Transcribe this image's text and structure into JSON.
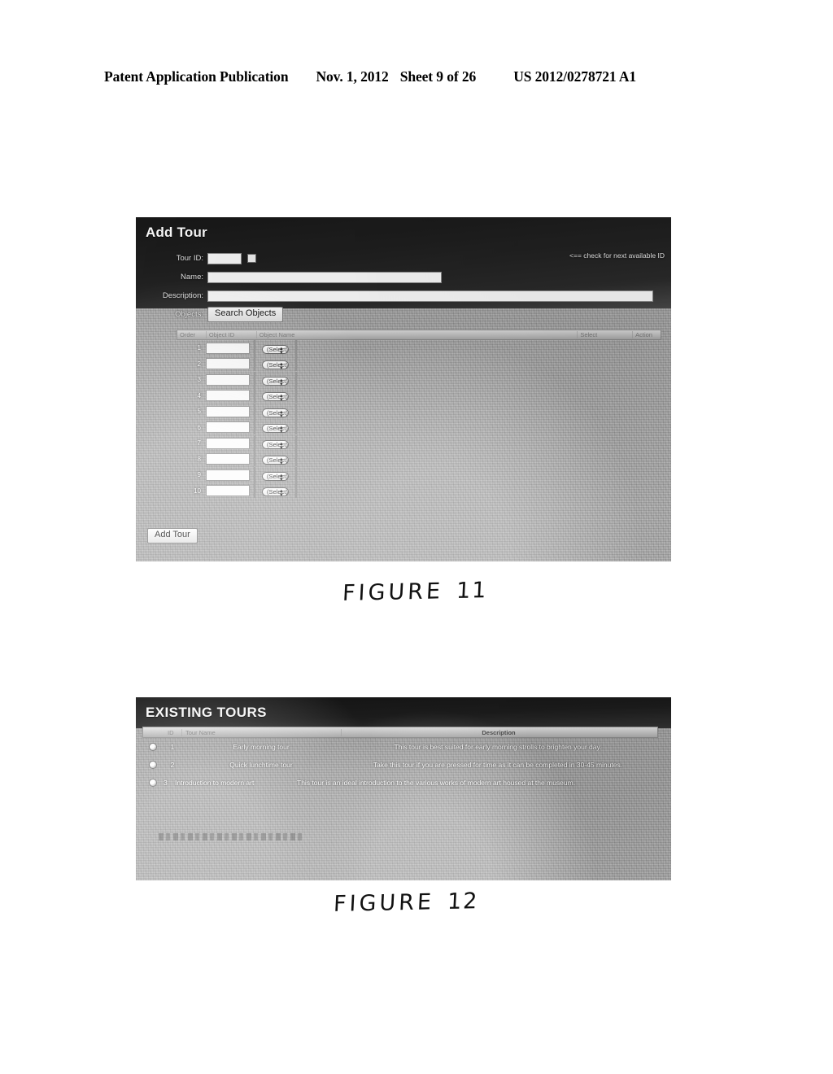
{
  "header": {
    "publication": "Patent Application Publication",
    "date": "Nov. 1, 2012",
    "sheet": "Sheet 9 of 26",
    "patent_number": "US 2012/0278721 A1"
  },
  "figure11": {
    "caption_word": "FIGURE",
    "caption_number": "11",
    "window_title": "Add Tour",
    "fields": {
      "tour_id_label": "Tour ID:",
      "tour_id_value": "",
      "name_label": "Name:",
      "name_value": "",
      "description_label": "Description:",
      "description_value": "",
      "objects_label": "Objects:"
    },
    "hint": "<== check for next available ID",
    "search_objects_button": "Search Objects",
    "add_tour_button": "Add Tour",
    "table": {
      "columns": [
        "Order",
        "Object ID",
        "Object Name",
        "Select",
        "Action"
      ],
      "select_placeholder": "(Select)",
      "stepper_icon": "up-down-stepper-icon",
      "rows": [
        {
          "num": "1",
          "object_id": "",
          "object_name": "",
          "select": "(Select)",
          "action": ""
        },
        {
          "num": "2",
          "object_id": "",
          "object_name": "",
          "select": "(Select)",
          "action": ""
        },
        {
          "num": "3",
          "object_id": "",
          "object_name": "",
          "select": "(Select)",
          "action": ""
        },
        {
          "num": "4",
          "object_id": "",
          "object_name": "",
          "select": "(Select)",
          "action": ""
        },
        {
          "num": "5",
          "object_id": "",
          "object_name": "",
          "select": "(Select)",
          "action": ""
        },
        {
          "num": "6",
          "object_id": "",
          "object_name": "",
          "select": "(Select)",
          "action": ""
        },
        {
          "num": "7",
          "object_id": "",
          "object_name": "",
          "select": "(Select)",
          "action": ""
        },
        {
          "num": "8",
          "object_id": "",
          "object_name": "",
          "select": "(Select)",
          "action": ""
        },
        {
          "num": "9",
          "object_id": "",
          "object_name": "",
          "select": "(Select)",
          "action": ""
        },
        {
          "num": "10",
          "object_id": "",
          "object_name": "",
          "select": "(Select)",
          "action": ""
        }
      ]
    }
  },
  "figure12": {
    "caption_word": "FIGURE",
    "caption_number": "12",
    "window_title": "EXISTING TOURS",
    "table": {
      "columns": [
        "",
        "ID",
        "Tour Name",
        "Description"
      ],
      "rows": [
        {
          "id": "1",
          "name": "Early morning tour",
          "description": "This tour is best suited for early morning strolls to brighten your day."
        },
        {
          "id": "2",
          "name": "Quick lunchtime tour",
          "description": "Take this tour if you are pressed for time as it can be completed in 30-45 minutes."
        },
        {
          "id": "3",
          "name": "Introduction to modern art",
          "description": "This tour is an ideal introduction to the various works of modern art housed at the museum."
        }
      ]
    }
  }
}
